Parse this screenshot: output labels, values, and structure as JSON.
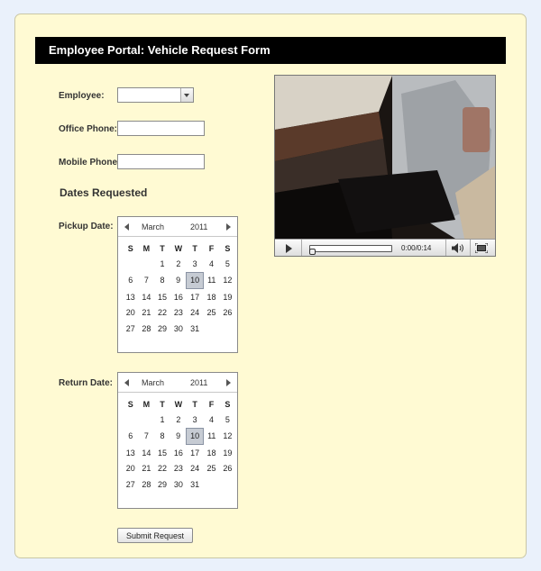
{
  "header": {
    "title": "Employee Portal: Vehicle Request Form"
  },
  "form": {
    "employee_label": "Employee:",
    "employee_value": "",
    "office_phone_label": "Office Phone:",
    "office_phone_value": "",
    "mobile_phone_label": "Mobile Phone:",
    "mobile_phone_value": "",
    "dates_section_title": "Dates Requested",
    "pickup_label": "Pickup Date:",
    "return_label": "Return Date:",
    "submit_label": "Submit Request"
  },
  "calendars": {
    "pickup": {
      "month": "March",
      "year": "2011",
      "weekdays": [
        "S",
        "M",
        "T",
        "W",
        "T",
        "F",
        "S"
      ],
      "weeks": [
        [
          "",
          "",
          "1",
          "2",
          "3",
          "4",
          "5"
        ],
        [
          "6",
          "7",
          "8",
          "9",
          "10",
          "11",
          "12"
        ],
        [
          "13",
          "14",
          "15",
          "16",
          "17",
          "18",
          "19"
        ],
        [
          "20",
          "21",
          "22",
          "23",
          "24",
          "25",
          "26"
        ],
        [
          "27",
          "28",
          "29",
          "30",
          "31",
          "",
          ""
        ]
      ],
      "selected": "10"
    },
    "return": {
      "month": "March",
      "year": "2011",
      "weekdays": [
        "S",
        "M",
        "T",
        "W",
        "T",
        "F",
        "S"
      ],
      "weeks": [
        [
          "",
          "",
          "1",
          "2",
          "3",
          "4",
          "5"
        ],
        [
          "6",
          "7",
          "8",
          "9",
          "10",
          "11",
          "12"
        ],
        [
          "13",
          "14",
          "15",
          "16",
          "17",
          "18",
          "19"
        ],
        [
          "20",
          "21",
          "22",
          "23",
          "24",
          "25",
          "26"
        ],
        [
          "27",
          "28",
          "29",
          "30",
          "31",
          "",
          ""
        ]
      ],
      "selected": "10"
    }
  },
  "video": {
    "time": "0:00/0:14",
    "progress": 0,
    "icons": {
      "play": "play-icon",
      "volume": "volume-icon",
      "fullscreen": "fullscreen-icon"
    }
  },
  "colors": {
    "panel_bg": "#fffad3",
    "page_bg": "#eaf1fb",
    "title_bg": "#000000"
  }
}
